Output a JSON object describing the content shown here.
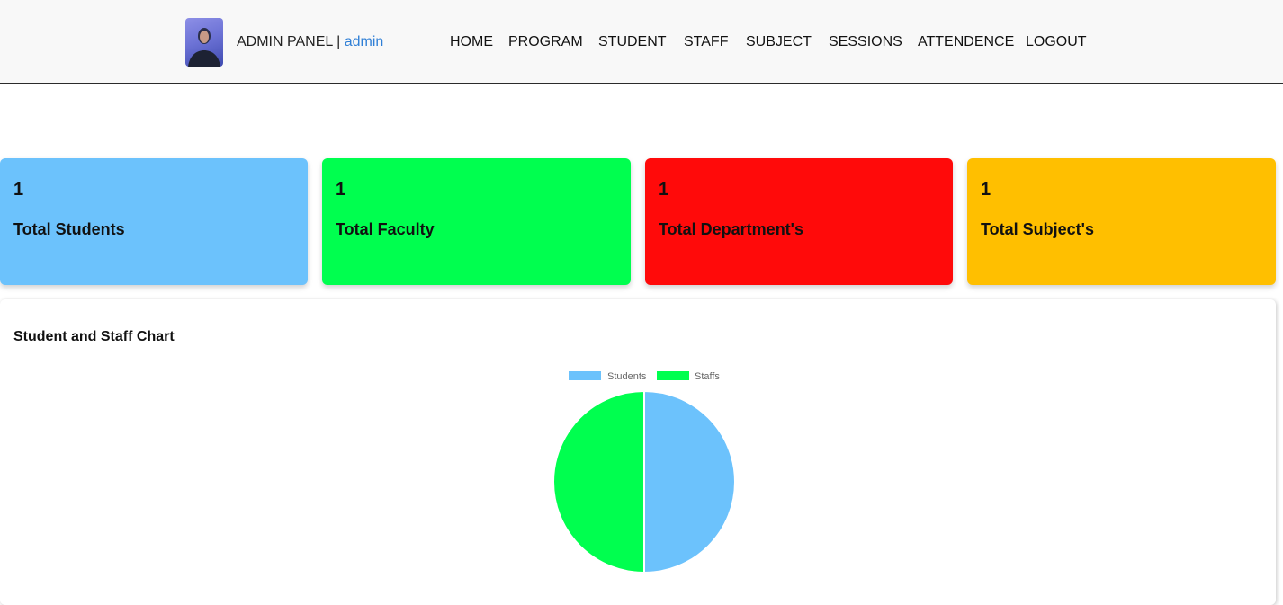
{
  "header": {
    "brand_text": "ADMIN PANEL | ",
    "username": "admin",
    "nav": [
      {
        "label": "HOME"
      },
      {
        "label": "PROGRAM"
      },
      {
        "label": "STUDENT"
      },
      {
        "label": "STAFF"
      },
      {
        "label": "SUBJECT"
      },
      {
        "label": "SESSIONS"
      },
      {
        "label": "ATTENDENCE"
      },
      {
        "label": "LOGOUT"
      }
    ]
  },
  "cards": [
    {
      "count": "1",
      "label": "Total Students",
      "color": "#6cc2fc"
    },
    {
      "count": "1",
      "label": "Total Faculty",
      "color": "#00ff4f"
    },
    {
      "count": "1",
      "label": "Total Department's",
      "color": "#ff0a0a"
    },
    {
      "count": "1",
      "label": "Total Subject's",
      "color": "#ffbf00"
    }
  ],
  "chart_section": {
    "title": "Student and Staff Chart"
  },
  "chart_data": {
    "type": "pie",
    "title": "Student and Staff Chart",
    "categories": [
      "Students",
      "Staffs"
    ],
    "values": [
      1,
      1
    ],
    "colors": [
      "#6cc2fc",
      "#00ff4f"
    ],
    "legend": "top"
  }
}
